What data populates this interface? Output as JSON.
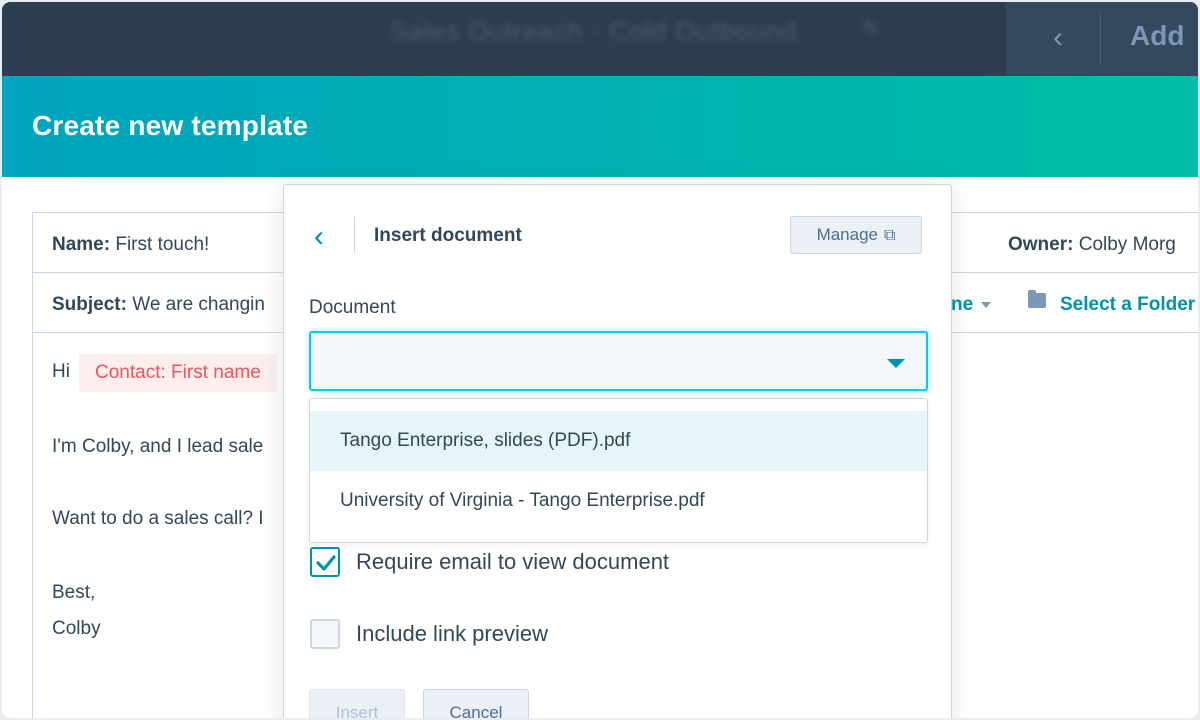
{
  "topbar": {
    "blurred_title": "Sales Outreach · Cold Outbound",
    "back_icon": "chevron-left-icon",
    "add_label": "Add"
  },
  "header": {
    "title": "Create new template"
  },
  "template": {
    "name_label": "Name:",
    "name_value": "First touch!",
    "owner_label": "Owner:",
    "owner_value": "Colby Morg",
    "subject_label": "Subject:",
    "subject_value": "We are changin",
    "share_value": "ne",
    "folder_link": "Select a Folder",
    "body": {
      "greeting": "Hi",
      "token": "Contact: First name",
      "line1": "I'm Colby, and I lead sale",
      "line2": "Want to do a sales call? I",
      "signoff1": "Best,",
      "signoff2": "Colby"
    }
  },
  "modal": {
    "title": "Insert document",
    "manage_label": "Manage",
    "document_label": "Document",
    "options": [
      "Tango Enterprise, slides (PDF).pdf",
      "University of Virginia - Tango Enterprise.pdf"
    ],
    "checkboxes": [
      {
        "label": "Require email to view document",
        "checked": true
      },
      {
        "label": "Include link preview",
        "checked": false
      }
    ],
    "insert_label": "Insert",
    "cancel_label": "Cancel"
  },
  "colors": {
    "topbar": "#2d3e50",
    "header_start": "#00a4bd",
    "header_end": "#00bda5",
    "accent": "#0091ae",
    "token_text": "#f2545b"
  }
}
